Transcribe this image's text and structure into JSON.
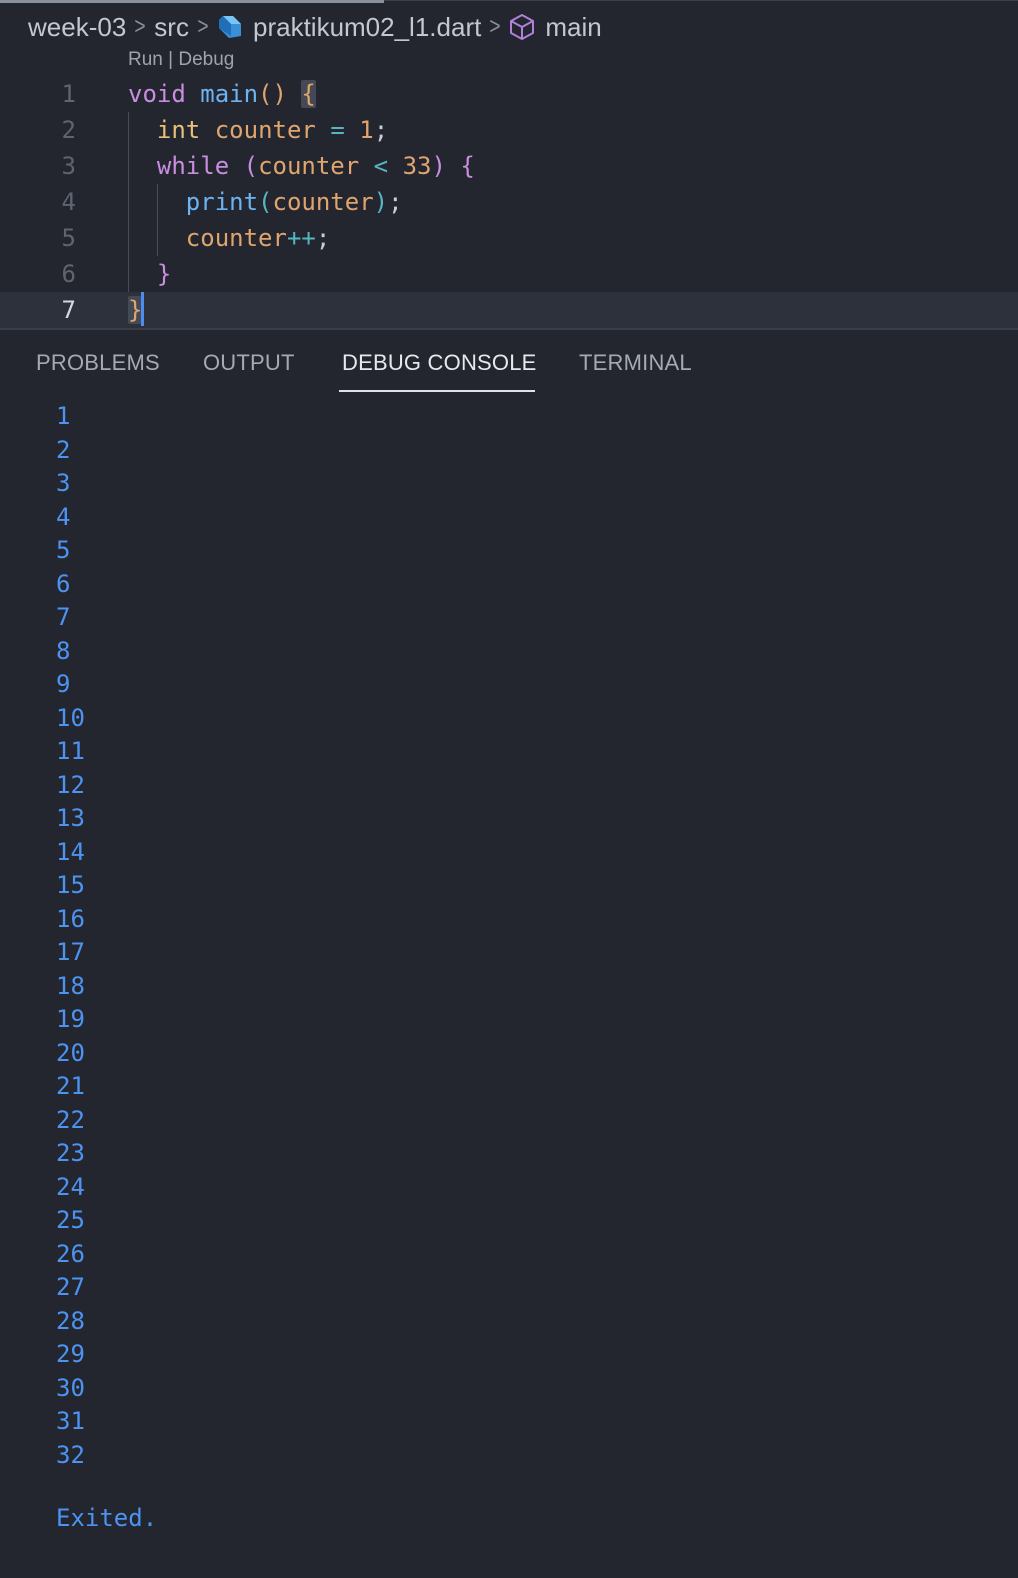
{
  "breadcrumb": {
    "items": [
      {
        "label": "week-03",
        "icon": ""
      },
      {
        "label": "src",
        "icon": ""
      },
      {
        "label": "praktikum02_l1.dart",
        "icon": "dart-file-icon"
      },
      {
        "label": "main",
        "icon": "cube-method-icon"
      }
    ],
    "separator": ">"
  },
  "codelens": {
    "run": "Run",
    "divider": " | ",
    "debug": "Debug"
  },
  "editor": {
    "line_numbers": [
      "1",
      "2",
      "3",
      "4",
      "5",
      "6",
      "7"
    ],
    "current_line": 7,
    "lines": [
      [
        {
          "t": "void",
          "c": "kw"
        },
        {
          "t": " ",
          "c": "pun"
        },
        {
          "t": "main",
          "c": "fn"
        },
        {
          "t": "()",
          "c": "par"
        },
        {
          "t": " ",
          "c": "pun"
        },
        {
          "t": "{",
          "c": "br1 bracket-hl"
        }
      ],
      [
        {
          "t": "  ",
          "c": "pun"
        },
        {
          "t": "int",
          "c": "ty"
        },
        {
          "t": " ",
          "c": "pun"
        },
        {
          "t": "counter",
          "c": "var"
        },
        {
          "t": " ",
          "c": "pun"
        },
        {
          "t": "=",
          "c": "op"
        },
        {
          "t": " ",
          "c": "pun"
        },
        {
          "t": "1",
          "c": "num"
        },
        {
          "t": ";",
          "c": "pun"
        }
      ],
      [
        {
          "t": "  ",
          "c": "pun"
        },
        {
          "t": "while",
          "c": "kw"
        },
        {
          "t": " ",
          "c": "pun"
        },
        {
          "t": "(",
          "c": "par2"
        },
        {
          "t": "counter",
          "c": "var"
        },
        {
          "t": " ",
          "c": "pun"
        },
        {
          "t": "<",
          "c": "op"
        },
        {
          "t": " ",
          "c": "pun"
        },
        {
          "t": "33",
          "c": "num"
        },
        {
          "t": ")",
          "c": "par2"
        },
        {
          "t": " ",
          "c": "pun"
        },
        {
          "t": "{",
          "c": "br2"
        }
      ],
      [
        {
          "t": "    ",
          "c": "pun"
        },
        {
          "t": "print",
          "c": "fn"
        },
        {
          "t": "(",
          "c": "par3"
        },
        {
          "t": "counter",
          "c": "var"
        },
        {
          "t": ")",
          "c": "par3"
        },
        {
          "t": ";",
          "c": "pun"
        }
      ],
      [
        {
          "t": "    ",
          "c": "pun"
        },
        {
          "t": "counter",
          "c": "var"
        },
        {
          "t": "++",
          "c": "op"
        },
        {
          "t": ";",
          "c": "pun"
        }
      ],
      [
        {
          "t": "  ",
          "c": "pun"
        },
        {
          "t": "}",
          "c": "br2"
        }
      ],
      [
        {
          "t": "}",
          "c": "br1 bracket-hl"
        }
      ]
    ]
  },
  "panel": {
    "tabs": [
      {
        "label": "PROBLEMS",
        "active": false
      },
      {
        "label": "OUTPUT",
        "active": false
      },
      {
        "label": "DEBUG CONSOLE",
        "active": true
      },
      {
        "label": "TERMINAL",
        "active": false
      }
    ]
  },
  "console": {
    "output": [
      "1",
      "2",
      "3",
      "4",
      "5",
      "6",
      "7",
      "8",
      "9",
      "10",
      "11",
      "12",
      "13",
      "14",
      "15",
      "16",
      "17",
      "18",
      "19",
      "20",
      "21",
      "22",
      "23",
      "24",
      "25",
      "26",
      "27",
      "28",
      "29",
      "30",
      "31",
      "32"
    ],
    "exit_message": "Exited."
  },
  "colors": {
    "background": "#23262f",
    "keyword": "#c98ee0",
    "function": "#6db3f2",
    "variable": "#e0a56e",
    "type": "#e7c07a",
    "console_text": "#4d93f2",
    "cursor": "#4d8cf0"
  }
}
